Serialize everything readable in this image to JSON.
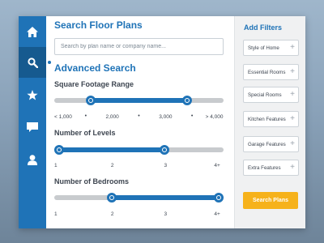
{
  "nav": {
    "items": [
      {
        "icon": "home-icon"
      },
      {
        "icon": "search-icon",
        "active": true
      },
      {
        "icon": "star-icon"
      },
      {
        "icon": "chat-icon"
      },
      {
        "icon": "user-icon"
      }
    ],
    "accent": "#1f73b7",
    "active_bg": "#165a8f"
  },
  "main": {
    "title": "Search Floor Plans",
    "search": {
      "placeholder": "Search by plan name or company name...",
      "value": ""
    },
    "advanced_title": "Advanced Search",
    "sliders": [
      {
        "label": "Square Footage Range",
        "ticks": [
          "< 1,000",
          "2,000",
          "3,000",
          "> 4,000"
        ],
        "range": [
          0.2,
          0.8
        ]
      },
      {
        "label": "Number of Levels",
        "ticks": [
          "1",
          "2",
          "3",
          "4+"
        ],
        "range": [
          0.0,
          0.66
        ]
      },
      {
        "label": "Number of Bedrooms",
        "ticks": [
          "1",
          "2",
          "3",
          "4+"
        ],
        "range": [
          0.33,
          1.0
        ]
      }
    ]
  },
  "filters": {
    "title": "Add Filters",
    "items": [
      "Style of Home",
      "Essential Rooms",
      "Special Rooms",
      "Kitchen Features",
      "Garage Features",
      "Extra Features"
    ],
    "button": "Search Plans",
    "button_color": "#f6b21b"
  }
}
